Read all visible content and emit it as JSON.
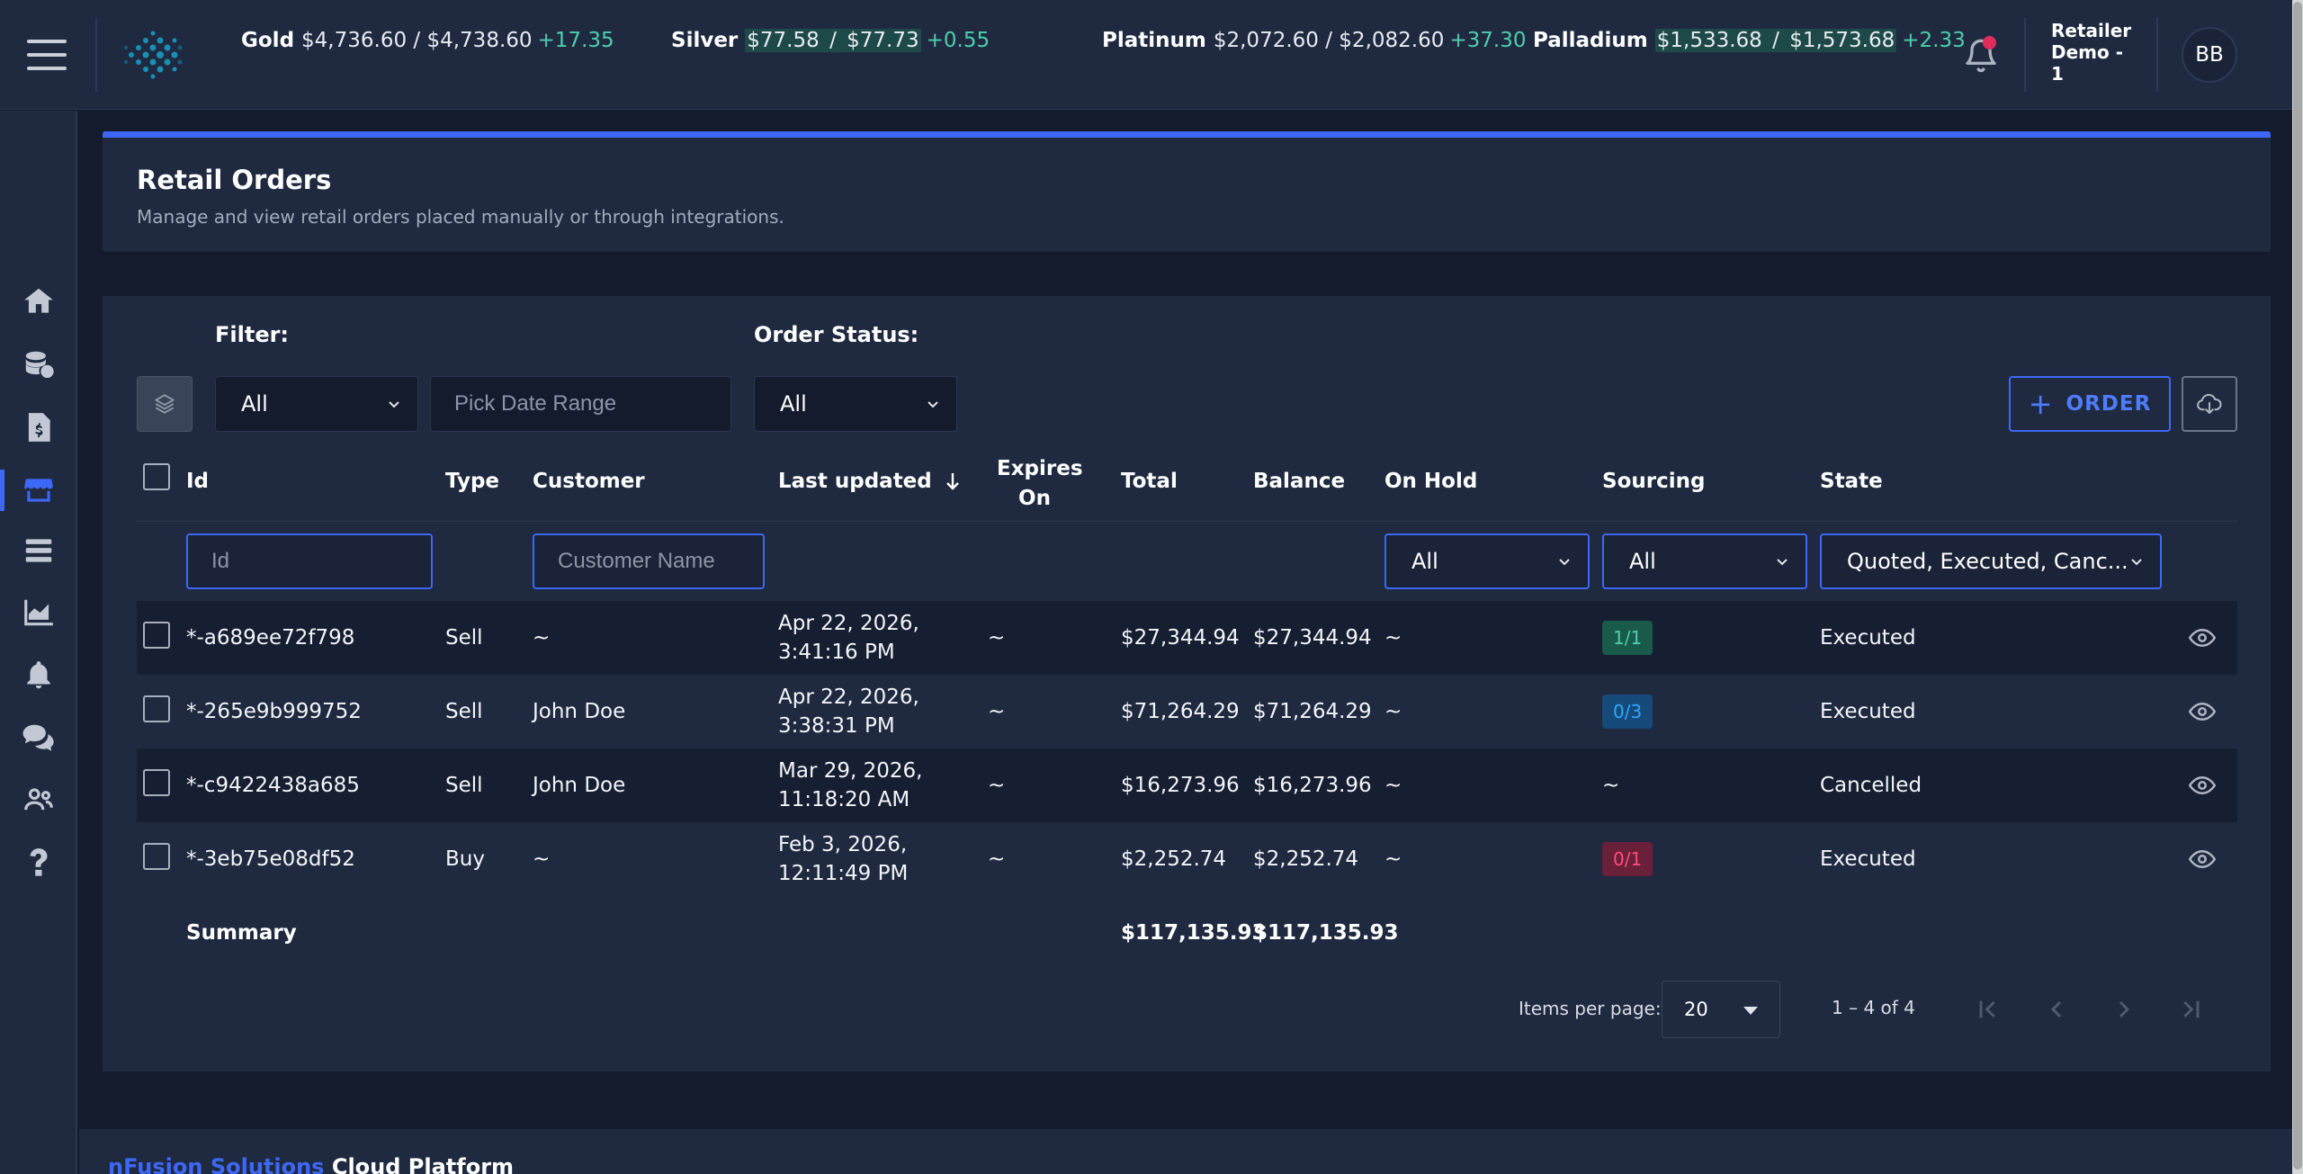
{
  "app": {
    "footer_brand": "nFusion Solutions",
    "footer_rest": " Cloud Platform"
  },
  "ticker": [
    {
      "metal": "Gold",
      "bid": "$4,736.60",
      "sep": " / ",
      "ask": "$4,738.60",
      "change": "+17.35"
    },
    {
      "metal": "Silver",
      "bid": "$77.58",
      "sep": " / ",
      "ask": "$77.73",
      "change": "+0.55"
    },
    {
      "metal": "Platinum",
      "bid": "$2,072.60",
      "sep": " / ",
      "ask": "$2,082.60",
      "change": "+37.30"
    },
    {
      "metal": "Palladium",
      "bid": "$1,533.68",
      "sep": " / ",
      "ask": "$1,573.68",
      "change": "+2.33"
    }
  ],
  "user": {
    "name": "Retailer Demo - 1",
    "initials": "BB"
  },
  "page": {
    "title": "Retail Orders",
    "subtitle": "Manage and view retail orders placed manually or through integrations."
  },
  "filters": {
    "filter_label": "Filter:",
    "filter_value": "All",
    "date_placeholder": "Pick Date Range",
    "status_label": "Order Status:",
    "status_value": "All",
    "order_button": "ORDER"
  },
  "table": {
    "headers": {
      "id": "Id",
      "type": "Type",
      "customer": "Customer",
      "last_updated": "Last updated",
      "expires_on": "Expires On",
      "total": "Total",
      "balance": "Balance",
      "on_hold": "On Hold",
      "sourcing": "Sourcing",
      "state": "State"
    },
    "column_filters": {
      "id_placeholder": "Id",
      "customer_placeholder": "Customer Name",
      "on_hold": "All",
      "sourcing": "All",
      "state": "Quoted, Executed, Canc..."
    },
    "rows": [
      {
        "id": "*-a689ee72f798",
        "type": "Sell",
        "customer": "~",
        "updated_date": "Apr 22, 2026,",
        "updated_time": "3:41:16 PM",
        "expires": "~",
        "total": "$27,344.94",
        "balance": "$27,344.94",
        "on_hold": "~",
        "sourcing": "1/1",
        "state": "Executed"
      },
      {
        "id": "*-265e9b999752",
        "type": "Sell",
        "customer": "John Doe",
        "updated_date": "Apr 22, 2026,",
        "updated_time": "3:38:31 PM",
        "expires": "~",
        "total": "$71,264.29",
        "balance": "$71,264.29",
        "on_hold": "~",
        "sourcing": "0/3",
        "state": "Executed"
      },
      {
        "id": "*-c9422438a685",
        "type": "Sell",
        "customer": "John Doe",
        "updated_date": "Mar 29, 2026,",
        "updated_time": "11:18:20 AM",
        "expires": "~",
        "total": "$16,273.96",
        "balance": "$16,273.96",
        "on_hold": "~",
        "sourcing": "~",
        "state": "Cancelled"
      },
      {
        "id": "*-3eb75e08df52",
        "type": "Buy",
        "customer": "~",
        "updated_date": "Feb 3, 2026,",
        "updated_time": "12:11:49 PM",
        "expires": "~",
        "total": "$2,252.74",
        "balance": "$2,252.74",
        "on_hold": "~",
        "sourcing": "0/1",
        "state": "Executed"
      }
    ],
    "summary": {
      "label": "Summary",
      "total": "$117,135.93",
      "balance": "$117,135.93"
    }
  },
  "pagination": {
    "items_per_page_label": "Items per page:",
    "page_size": "20",
    "range": "1 – 4 of 4"
  },
  "colors": {
    "accent": "#3d68f5",
    "positive": "#4cceac",
    "badge_green": "#1a5a4a",
    "badge_blue": "#164a7a",
    "badge_red": "#6a2038"
  }
}
